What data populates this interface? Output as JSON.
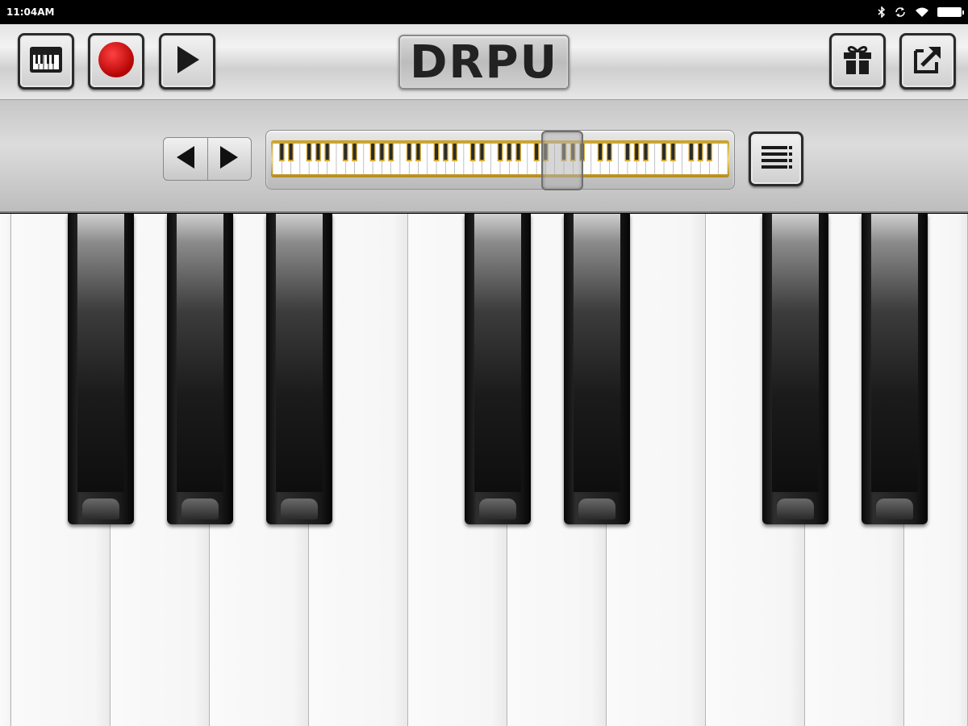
{
  "status_bar": {
    "time": "11:04AM",
    "icons": [
      "bluetooth-icon",
      "sync-icon",
      "wifi-icon",
      "battery-icon"
    ],
    "battery_level": 1.0
  },
  "toolbar": {
    "logo_text": "DRPU",
    "buttons": [
      "keyboard-icon",
      "record-icon",
      "play-icon",
      "gift-icon",
      "share-icon"
    ]
  },
  "navigator": {
    "arrows": [
      "arrow-left-icon",
      "arrow-right-icon"
    ],
    "menu_icon": "menu-icon",
    "mini_keyboard_octaves": 7,
    "viewport_position_fraction": 0.63
  },
  "piano": {
    "white_key_count": 10,
    "black_key_pattern": [
      true,
      true,
      true,
      false,
      true,
      true,
      false,
      true,
      true
    ]
  },
  "colors": {
    "record": "#d40000",
    "gold": "#d4a832"
  }
}
